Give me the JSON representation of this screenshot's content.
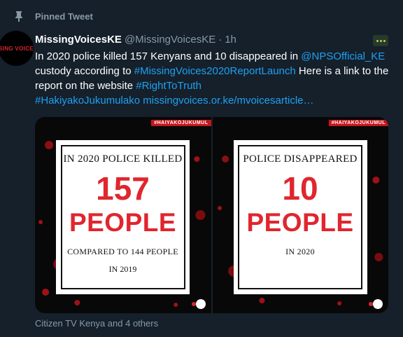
{
  "pinned_label": "Pinned Tweet",
  "avatar_text": "SING VOICE",
  "author": {
    "display_name": "MissingVoicesKE",
    "handle": "@MissingVoicesKE",
    "separator": "·",
    "time": "1h"
  },
  "tweet": {
    "text_1": "In 2020 police killed 157 Kenyans and 10 disappeared in ",
    "mention": "@NPSOfficial_KE",
    "text_2": " custody according to ",
    "hashtag_1": "#MissingVoices2020ReportLaunch",
    "text_3": " Here is a link to the report on the website ",
    "hashtag_2": "#RightToTruth",
    "hashtag_3": "#HakiyakoJukumulako",
    "link": "missingvoices.or.ke/mvoicesarticle…"
  },
  "media": [
    {
      "tag": "#HAIYAKOJUKUMUL",
      "line_top": "IN 2020 POLICE KILLED",
      "number": "157",
      "word": "PEOPLE",
      "line_sub": "COMPARED TO 144 PEOPLE",
      "line_sub2": "IN 2019"
    },
    {
      "tag": "#HAIYAKOJUKUMUL",
      "line_top": "POLICE DISAPPEARED",
      "number": "10",
      "word": "PEOPLE",
      "line_sub": "IN 2020",
      "line_sub2": ""
    }
  ],
  "footer": "Citizen TV Kenya and 4 others",
  "colors": {
    "background": "#15202b",
    "link": "#1da1f2",
    "muted": "#8899a6",
    "accent_red": "#e0262e"
  }
}
